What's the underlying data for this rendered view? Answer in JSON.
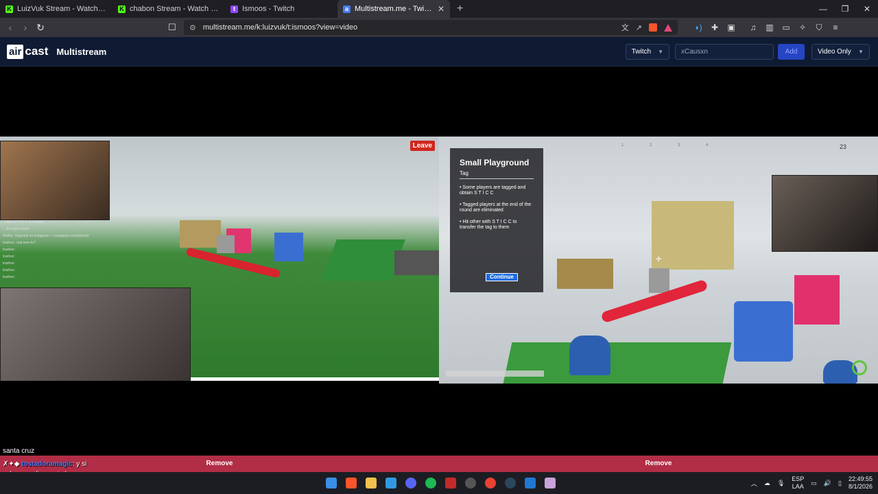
{
  "tabs": [
    {
      "title": "LuizVuk Stream - Watch Live on K",
      "icon": "kick-icon",
      "color": "#53fc18",
      "active": false
    },
    {
      "title": "chabon Stream - Watch Live on K",
      "icon": "kick-icon",
      "color": "#53fc18",
      "active": false
    },
    {
      "title": "Ismoos - Twitch",
      "icon": "twitch-icon",
      "color": "#9146ff",
      "active": false
    },
    {
      "title": "Multistream.me - Twitch.tv / K",
      "icon": "aircast-icon",
      "color": "#4a7bf5",
      "active": true
    }
  ],
  "address_bar": {
    "url": "multistream.me/k:luizvuk/t:ismoos?view=video"
  },
  "site": {
    "logo_air": "air",
    "logo_cast": "cast",
    "title": "Multistream",
    "platform_select": "Twitch",
    "channel_input_placeholder": "xCausxn",
    "add_label": "Add",
    "view_select": "Video Only"
  },
  "stream1": {
    "leave_label": "Leave",
    "chat_lines": [
      "... with S T I C C to transfer",
      "... the tag to them",
      "BotRix: Sígueme en instagram -> instagram.com/luizvuk/",
      "trashuv: cual eres tu?",
      "trashuv:",
      "trashuv:",
      "trashuv:",
      "trashuv:",
      "trashuv:",
      "trashuv:"
    ],
    "remove_label": "Remove"
  },
  "stream2": {
    "panel_title": "Small Playground",
    "panel_subtitle": "Tag",
    "panel_lines": [
      "• Some players are tagged and obtain S T I C C",
      "• Tagged players at the end of the round are eliminated",
      "• Hit other with S T I C C to transfer the tag to them"
    ],
    "continue_label": "Continue",
    "round_numbers": "1 2 3 4",
    "player_count": "23",
    "remove_label": "Remove"
  },
  "overlay": {
    "location": "santa cruz",
    "chat1_user": "tostadoramagic",
    "chat1_msg": ": y si volves un dia y esta lara",
    "chat2_user": "tostadoramagic",
    "chat2_msg": ":"
  },
  "taskbar": {
    "apps": [
      {
        "name": "windows-start-icon",
        "color": "#3a8ee6"
      },
      {
        "name": "brave-icon",
        "color": "#fb542b"
      },
      {
        "name": "file-explorer-icon",
        "color": "#f2c14e"
      },
      {
        "name": "bing-icon",
        "color": "#2f9ae0"
      },
      {
        "name": "discord-icon",
        "color": "#5865f2"
      },
      {
        "name": "spotify-icon",
        "color": "#1db954"
      },
      {
        "name": "news-app-icon",
        "color": "#c22b2b"
      },
      {
        "name": "obs-icon",
        "color": "#555555"
      },
      {
        "name": "chrome-icon",
        "color": "#e94235"
      },
      {
        "name": "steam-icon",
        "color": "#1b2838"
      },
      {
        "name": "defender-icon",
        "color": "#1f78d1"
      },
      {
        "name": "settings-app-icon",
        "color": "#c8a2d8"
      }
    ],
    "lang_top": "ESP",
    "lang_bottom": "LAA",
    "time": "22:49:55",
    "date": "8/1/2026"
  }
}
